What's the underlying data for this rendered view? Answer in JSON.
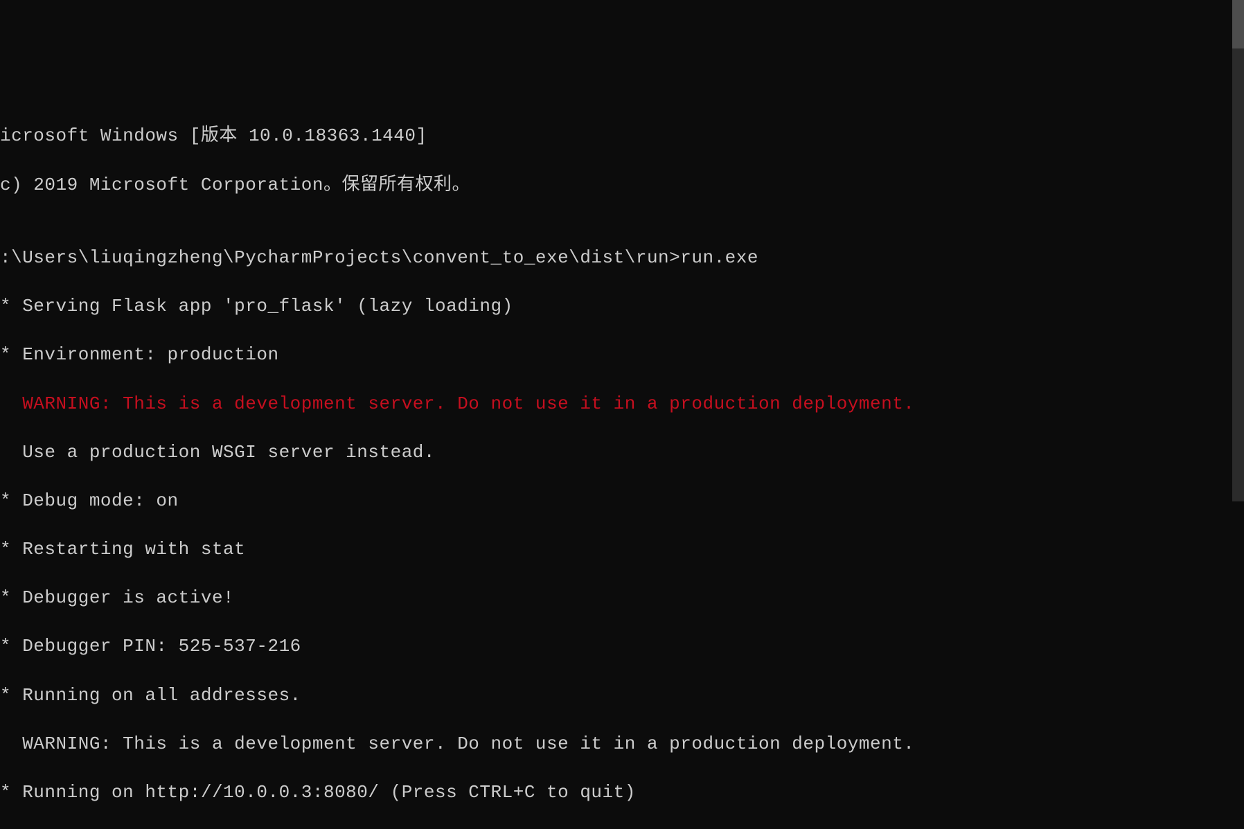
{
  "terminal": {
    "lines": [
      {
        "text": "icrosoft Windows [版本 10.0.18363.1440]",
        "color": "default"
      },
      {
        "text": "c) 2019 Microsoft Corporation。保留所有权利。",
        "color": "default"
      },
      {
        "text": "",
        "color": "default"
      },
      {
        "text": ":\\Users\\liuqingzheng\\PycharmProjects\\convent_to_exe\\dist\\run>run.exe",
        "color": "default"
      },
      {
        "text": "* Serving Flask app 'pro_flask' (lazy loading)",
        "color": "default"
      },
      {
        "text": "* Environment: production",
        "color": "default"
      },
      {
        "text": "  WARNING: This is a development server. Do not use it in a production deployment.",
        "color": "red"
      },
      {
        "text": "  Use a production WSGI server instead.",
        "color": "default"
      },
      {
        "text": "* Debug mode: on",
        "color": "default"
      },
      {
        "text": "* Restarting with stat",
        "color": "default"
      },
      {
        "text": "* Debugger is active!",
        "color": "default"
      },
      {
        "text": "* Debugger PIN: 525-537-216",
        "color": "default"
      },
      {
        "text": "* Running on all addresses.",
        "color": "default"
      },
      {
        "text": "  WARNING: This is a development server. Do not use it in a production deployment.",
        "color": "default"
      },
      {
        "text": "* Running on http://10.0.0.3:8080/ (Press CTRL+C to quit)",
        "color": "default"
      }
    ]
  }
}
